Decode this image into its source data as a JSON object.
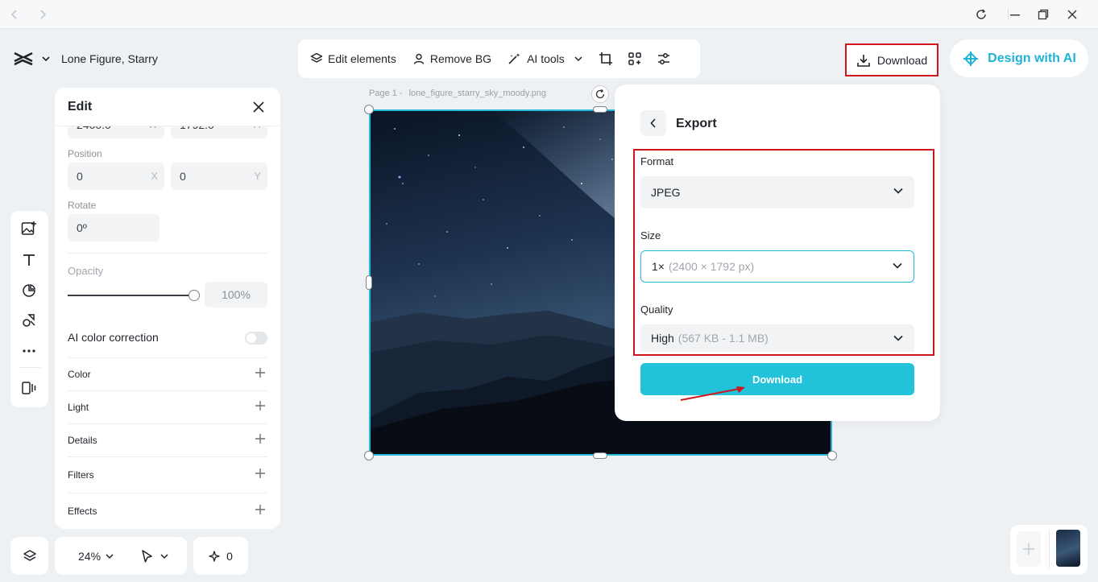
{
  "header": {
    "project_name": "Lone Figure, Starry",
    "download_label": "Download",
    "design_ai_label": "Design with AI"
  },
  "toolbar": {
    "edit_elements": "Edit elements",
    "remove_bg": "Remove BG",
    "ai_tools": "AI tools"
  },
  "edit_panel": {
    "title": "Edit",
    "width_value": "2400.0",
    "width_axis": "W",
    "height_value": "1792.0",
    "height_axis": "H",
    "position_label": "Position",
    "pos_x": "0",
    "pos_x_axis": "X",
    "pos_y": "0",
    "pos_y_axis": "Y",
    "rotate_label": "Rotate",
    "rotate_value": "0º",
    "opacity_label": "Opacity",
    "opacity_value": "100%",
    "ai_color_label": "AI color correction",
    "sections": [
      "Color",
      "Light",
      "Details",
      "Filters",
      "Effects"
    ]
  },
  "canvas": {
    "page_label": "Page 1 -",
    "file_name": "lone_figure_starry_sky_moody.png"
  },
  "export": {
    "title": "Export",
    "format_label": "Format",
    "format_value": "JPEG",
    "size_label": "Size",
    "size_value": "1×",
    "size_detail": "(2400 × 1792 px)",
    "quality_label": "Quality",
    "quality_value": "High",
    "quality_detail": "(567 KB - 1.1 MB)",
    "download_label": "Download"
  },
  "bottom": {
    "zoom": "24%",
    "ai_count": "0"
  },
  "colors": {
    "accent": "#22c3da",
    "highlight_red": "#d0161d",
    "ai_blue": "#1fb3d6"
  }
}
